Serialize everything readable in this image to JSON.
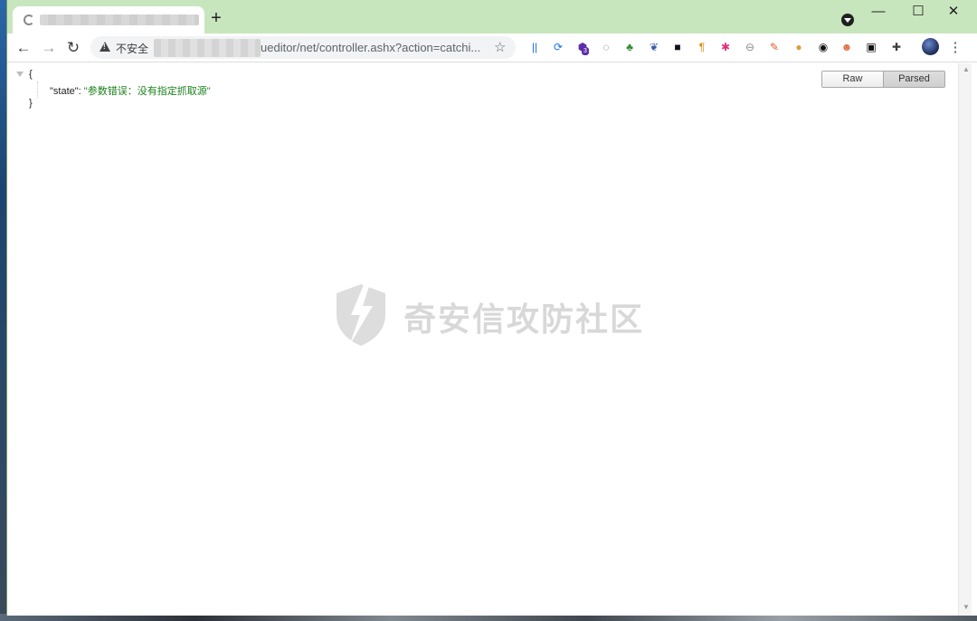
{
  "browser": {
    "new_tab_symbol": "+",
    "window_buttons": {
      "minimize": "—",
      "maximize": "☐",
      "close": "✕"
    },
    "security_label": "不安全",
    "url_visible": "ueditor/net/controller.ashx?action=catchi...",
    "menu_symbol": "⋮"
  },
  "extensions": [
    {
      "name": "reader-icon",
      "glyph": "||",
      "color": "#1a73e8"
    },
    {
      "name": "sync-icon",
      "glyph": "⟳",
      "color": "#1a73e8"
    },
    {
      "name": "cube-icon",
      "glyph": "⬢",
      "color": "#5b2ea8",
      "badge": "3"
    },
    {
      "name": "translate-icon",
      "glyph": "◌",
      "color": "#5f6368"
    },
    {
      "name": "puzzle-green-icon",
      "glyph": "♣",
      "color": "#2e8b2e"
    },
    {
      "name": "wappalyzer-icon",
      "glyph": "❦",
      "color": "#3b5aa8"
    },
    {
      "name": "dark-square-icon",
      "glyph": "■",
      "color": "#101020"
    },
    {
      "name": "pilcrow-icon",
      "glyph": "¶",
      "color": "#e08a00"
    },
    {
      "name": "star-burst-icon",
      "glyph": "✱",
      "color": "#e0307a"
    },
    {
      "name": "block-icon",
      "glyph": "⊖",
      "color": "#8a8a8a"
    },
    {
      "name": "brush-icon",
      "glyph": "✎",
      "color": "#e05a2a"
    },
    {
      "name": "cookie-icon",
      "glyph": "●",
      "color": "#d9a040"
    },
    {
      "name": "ring-icon",
      "glyph": "◉",
      "color": "#111111"
    },
    {
      "name": "bug-icon",
      "glyph": "☻",
      "color": "#e07040"
    },
    {
      "name": "robot-icon",
      "glyph": "▣",
      "color": "#111111"
    },
    {
      "name": "extensions-puzzle-icon",
      "glyph": "✚",
      "color": "#3c3c3c"
    }
  ],
  "json": {
    "open_brace": "{",
    "key": "\"state\"",
    "colon": ": ",
    "value": "\"参数错误：没有指定抓取源\"",
    "close_brace": "}"
  },
  "view_toggle": {
    "raw": "Raw",
    "parsed": "Parsed"
  },
  "watermark": {
    "text": "奇安信攻防社区"
  }
}
